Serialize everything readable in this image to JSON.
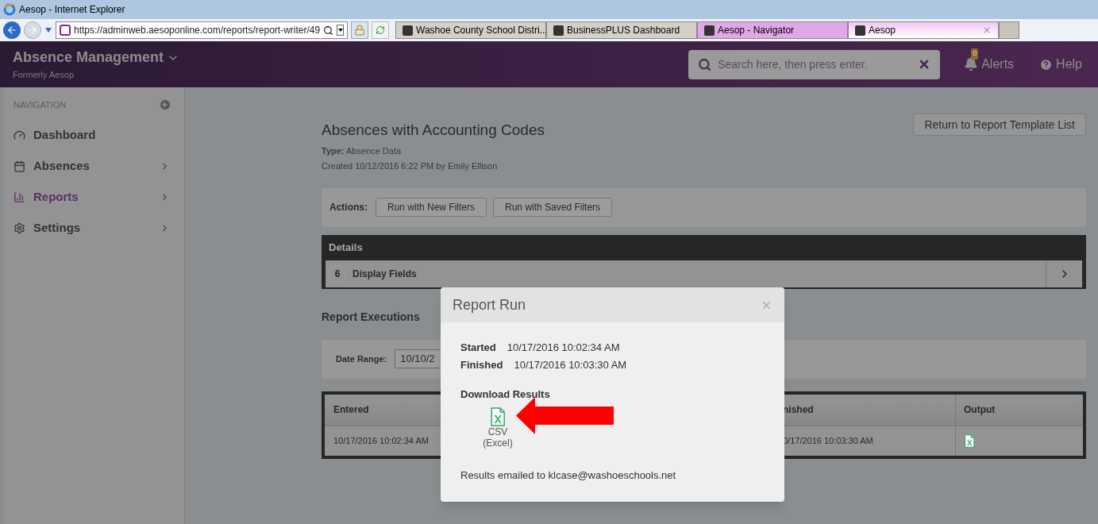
{
  "browser": {
    "title": "Aesop - Internet Explorer",
    "url": "https://adminweb.aesoponline.com/reports/report-writer/49",
    "tabs": [
      {
        "label": "Washoe County School Distri...",
        "selected": false,
        "color": "#d4d0c8"
      },
      {
        "label": "BusinessPLUS Dashboard",
        "selected": false,
        "color": "#d4d0c8"
      },
      {
        "label": "Aesop - Navigator",
        "selected": false,
        "color": "#e0a8e8"
      },
      {
        "label": "Aesop",
        "selected": true,
        "color": "#f2c6f2"
      }
    ]
  },
  "app": {
    "name": "Absence Management",
    "subtitle": "Formerly Aesop",
    "search": {
      "placeholder": "Search here, then press enter."
    },
    "alerts": {
      "label": "Alerts",
      "count": "0"
    },
    "help": {
      "label": "Help"
    }
  },
  "sidebar": {
    "heading": "NAVIGATION",
    "items": [
      {
        "label": "Dashboard",
        "selected": false,
        "expandable": false
      },
      {
        "label": "Absences",
        "selected": false,
        "expandable": true
      },
      {
        "label": "Reports",
        "selected": true,
        "expandable": true
      },
      {
        "label": "Settings",
        "selected": false,
        "expandable": true
      }
    ]
  },
  "report": {
    "title": "Absences with Accounting Codes",
    "type_label": "Type:",
    "type_value": "Absence Data",
    "created": "Created 10/12/2016 6:22 PM by Emily Ellison",
    "return_button": "Return to Report Template List",
    "actions_label": "Actions:",
    "actions": [
      "Run with New Filters",
      "Run with Saved Filters"
    ],
    "details": {
      "heading": "Details",
      "count": "6",
      "label": "Display Fields"
    },
    "executions_heading": "Report Executions",
    "date_range_label": "Date Range:",
    "date_range_value": "10/10/2",
    "table": {
      "columns": [
        "Entered",
        "nished",
        "Output"
      ],
      "rows": [
        {
          "entered": "10/17/2016 10:02:34 AM",
          "finished": "0/17/2016 10:03:30 AM"
        }
      ]
    }
  },
  "modal": {
    "title": "Report Run",
    "started_label": "Started",
    "started": "10/17/2016 10:02:34 AM",
    "finished_label": "Finished",
    "finished": "10/17/2016 10:03:30 AM",
    "download_heading": "Download Results",
    "download_lines": [
      "CSV",
      "(Excel)"
    ],
    "email": "Results emailed to klcase@washoeschools.net"
  }
}
